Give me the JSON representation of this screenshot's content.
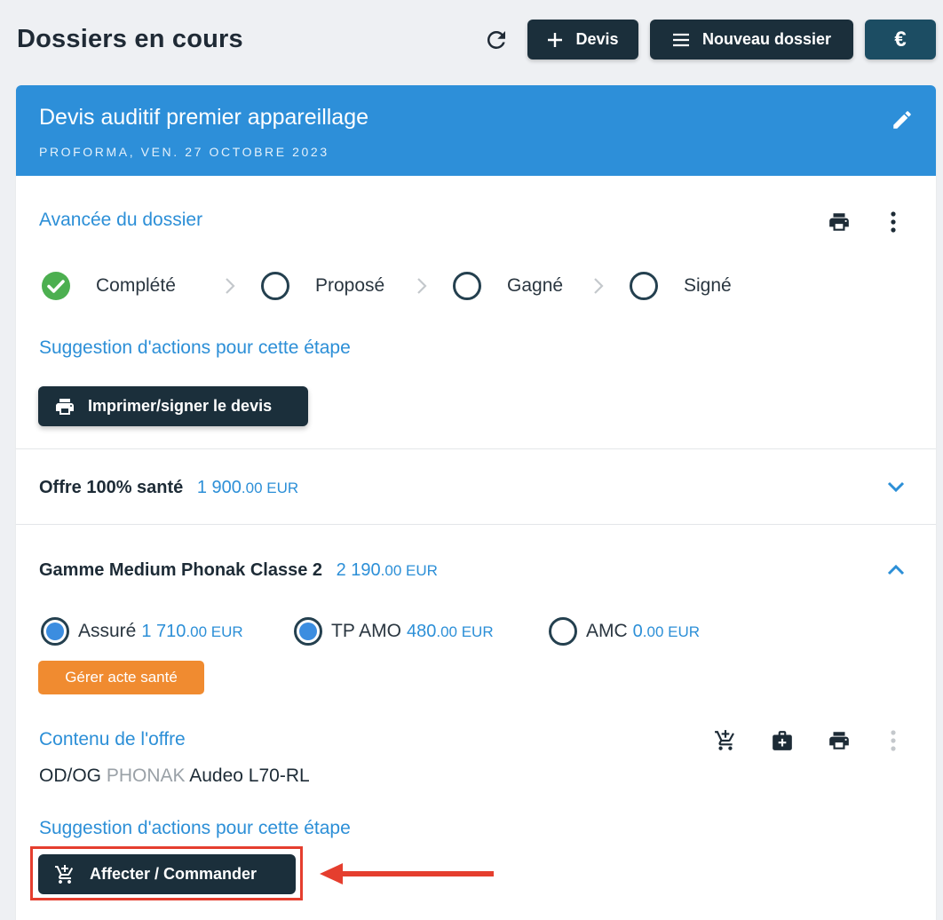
{
  "header": {
    "title": "Dossiers en cours",
    "devis_label": "Devis",
    "nouveau_label": "Nouveau dossier",
    "euro_label": "€"
  },
  "card": {
    "title": "Devis auditif premier appareillage",
    "subtitle": "PROFORMA, VEN. 27 OCTOBRE 2023"
  },
  "progress": {
    "label": "Avancée du dossier",
    "steps": [
      {
        "label": "Complété",
        "done": true
      },
      {
        "label": "Proposé",
        "done": false
      },
      {
        "label": "Gagné",
        "done": false
      },
      {
        "label": "Signé",
        "done": false
      }
    ],
    "suggestion_label": "Suggestion d'actions pour cette étape",
    "print_button": "Imprimer/signer le devis"
  },
  "offers": [
    {
      "name": "Offre 100% santé",
      "amount": "1 900",
      "cents": ".00 EUR",
      "expanded": false
    },
    {
      "name": "Gamme Medium Phonak Classe 2",
      "amount": "2 190",
      "cents": ".00 EUR",
      "expanded": true
    }
  ],
  "payers": [
    {
      "label": "Assuré",
      "amount": "1 710",
      "cents": ".00 EUR",
      "selected": true
    },
    {
      "label": "TP AMO",
      "amount": "480",
      "cents": ".00 EUR",
      "selected": true
    },
    {
      "label": "AMC",
      "amount": "0",
      "cents": ".00 EUR",
      "selected": false
    }
  ],
  "manage_button": "Gérer acte santé",
  "content": {
    "label": "Contenu de l'offre",
    "side": "OD/OG",
    "brand": "PHONAK",
    "model": "Audeo L70-RL",
    "suggestion_label": "Suggestion d'actions pour cette étape",
    "action_button": "Affecter / Commander"
  },
  "colors": {
    "accent": "#2c8fd7",
    "header_bg": "#2d8fd9",
    "dark_button": "#1b2f3b",
    "orange": "#f08b30",
    "highlight": "#e53e2e",
    "success": "#4caf50"
  }
}
